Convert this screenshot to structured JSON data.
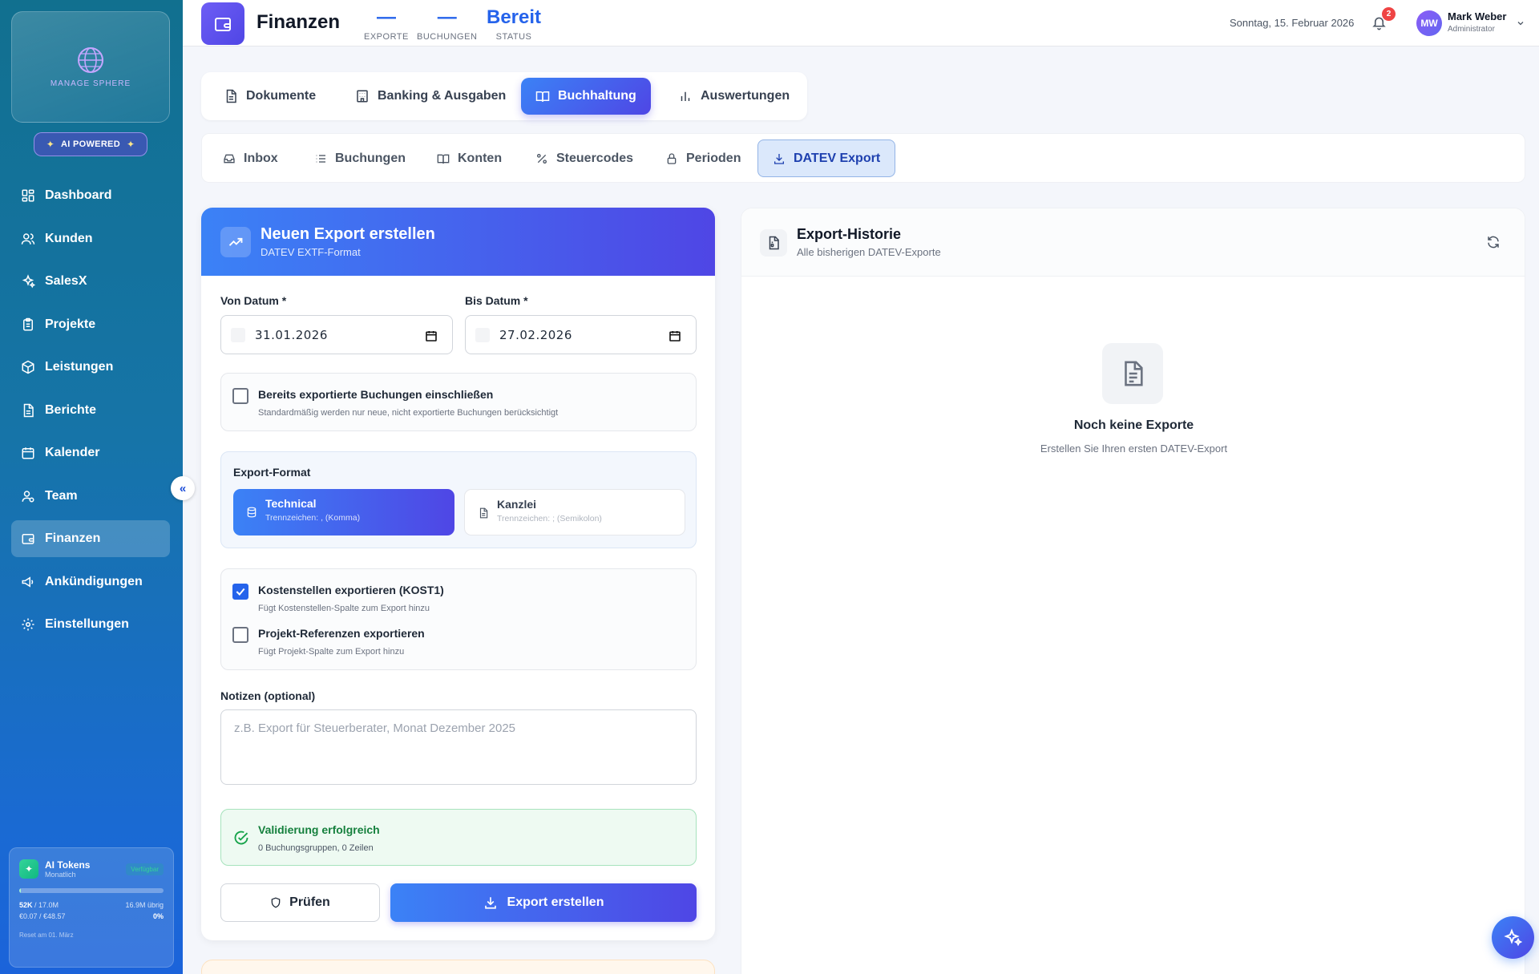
{
  "sidebar": {
    "logo_text": "MANAGE SPHERE",
    "ai_badge": "AI POWERED",
    "items": [
      {
        "label": "Dashboard",
        "icon": "grid-icon"
      },
      {
        "label": "Kunden",
        "icon": "users-icon"
      },
      {
        "label": "SalesX",
        "icon": "sparkles-icon"
      },
      {
        "label": "Projekte",
        "icon": "clipboard-icon"
      },
      {
        "label": "Leistungen",
        "icon": "package-icon"
      },
      {
        "label": "Berichte",
        "icon": "file-icon"
      },
      {
        "label": "Kalender",
        "icon": "calendar-icon"
      },
      {
        "label": "Team",
        "icon": "user-icon"
      },
      {
        "label": "Finanzen",
        "icon": "wallet-icon",
        "active": true
      },
      {
        "label": "Ankündigungen",
        "icon": "megaphone-icon"
      },
      {
        "label": "Einstellungen",
        "icon": "gear-icon"
      }
    ],
    "collapse_label": "«",
    "tokens": {
      "title": "AI Tokens",
      "period": "Monatlich",
      "status": "Verfügbar",
      "used": "52K",
      "total": "/ 17.0M",
      "remaining": "16.9M übrig",
      "cost": "€0.07 / €48.57",
      "percent": "0%",
      "usage_fraction": 0.003,
      "reset": "Reset am 01. März"
    }
  },
  "header": {
    "title": "Finanzen",
    "stats": [
      {
        "value": "—",
        "label": "EXPORTE"
      },
      {
        "value": "—",
        "label": "BUCHUNGEN"
      },
      {
        "value": "Bereit",
        "label": "STATUS"
      }
    ],
    "date": "Sonntag, 15. Februar 2026",
    "notifications": "2",
    "user": {
      "initials": "MW",
      "name": "Mark Weber",
      "role": "Administrator"
    }
  },
  "main_tabs": [
    {
      "label": "Dokumente",
      "icon": "document-icon"
    },
    {
      "label": "Banking & Ausgaben",
      "icon": "bank-icon"
    },
    {
      "label": "Buchhaltung",
      "icon": "book-icon",
      "active": true
    },
    {
      "label": "Auswertungen",
      "icon": "bar-chart-icon"
    }
  ],
  "sub_tabs": [
    {
      "label": "Inbox",
      "icon": "inbox-icon"
    },
    {
      "label": "Buchungen",
      "icon": "list-icon"
    },
    {
      "label": "Konten",
      "icon": "book-icon"
    },
    {
      "label": "Steuercodes",
      "icon": "percent-icon"
    },
    {
      "label": "Perioden",
      "icon": "lock-icon"
    },
    {
      "label": "DATEV Export",
      "icon": "download-icon",
      "active": true
    }
  ],
  "export_form": {
    "title": "Neuen Export erstellen",
    "subtitle": "DATEV EXTF-Format",
    "from_label": "Von Datum *",
    "from_value": "31.01.2026",
    "to_label": "Bis Datum *",
    "to_value": "27.02.2026",
    "include_exported": {
      "label": "Bereits exportierte Buchungen einschließen",
      "hint": "Standardmäßig werden nur neue, nicht exportierte Buchungen berücksichtigt",
      "checked": false
    },
    "format_label": "Export-Format",
    "formats": [
      {
        "title": "Technical",
        "hint": "Trennzeichen: , (Komma)",
        "active": true
      },
      {
        "title": "Kanzlei",
        "hint": "Trennzeichen: ; (Semikolon)",
        "active": false
      }
    ],
    "options": [
      {
        "label": "Kostenstellen exportieren (KOST1)",
        "hint": "Fügt Kostenstellen-Spalte zum Export hinzu",
        "checked": true
      },
      {
        "label": "Projekt-Referenzen exportieren",
        "hint": "Fügt Projekt-Spalte zum Export hinzu",
        "checked": false
      }
    ],
    "notes_label": "Notizen (optional)",
    "notes_placeholder": "z.B. Export für Steuerberater, Monat Dezember 2025",
    "validation_title": "Validierung erfolgreich",
    "validation_detail": "0 Buchungsgruppen, 0 Zeilen",
    "check_button": "Prüfen",
    "export_button": "Export erstellen"
  },
  "history": {
    "title": "Export-Historie",
    "subtitle": "Alle bisherigen DATEV-Exporte",
    "empty_title": "Noch keine Exporte",
    "empty_subtitle": "Erstellen Sie Ihren ersten DATEV-Export"
  },
  "colors": {
    "accent": "#3b82f6",
    "accent_dark": "#4f46e5",
    "success": "#16a34a",
    "danger": "#ef4444"
  }
}
